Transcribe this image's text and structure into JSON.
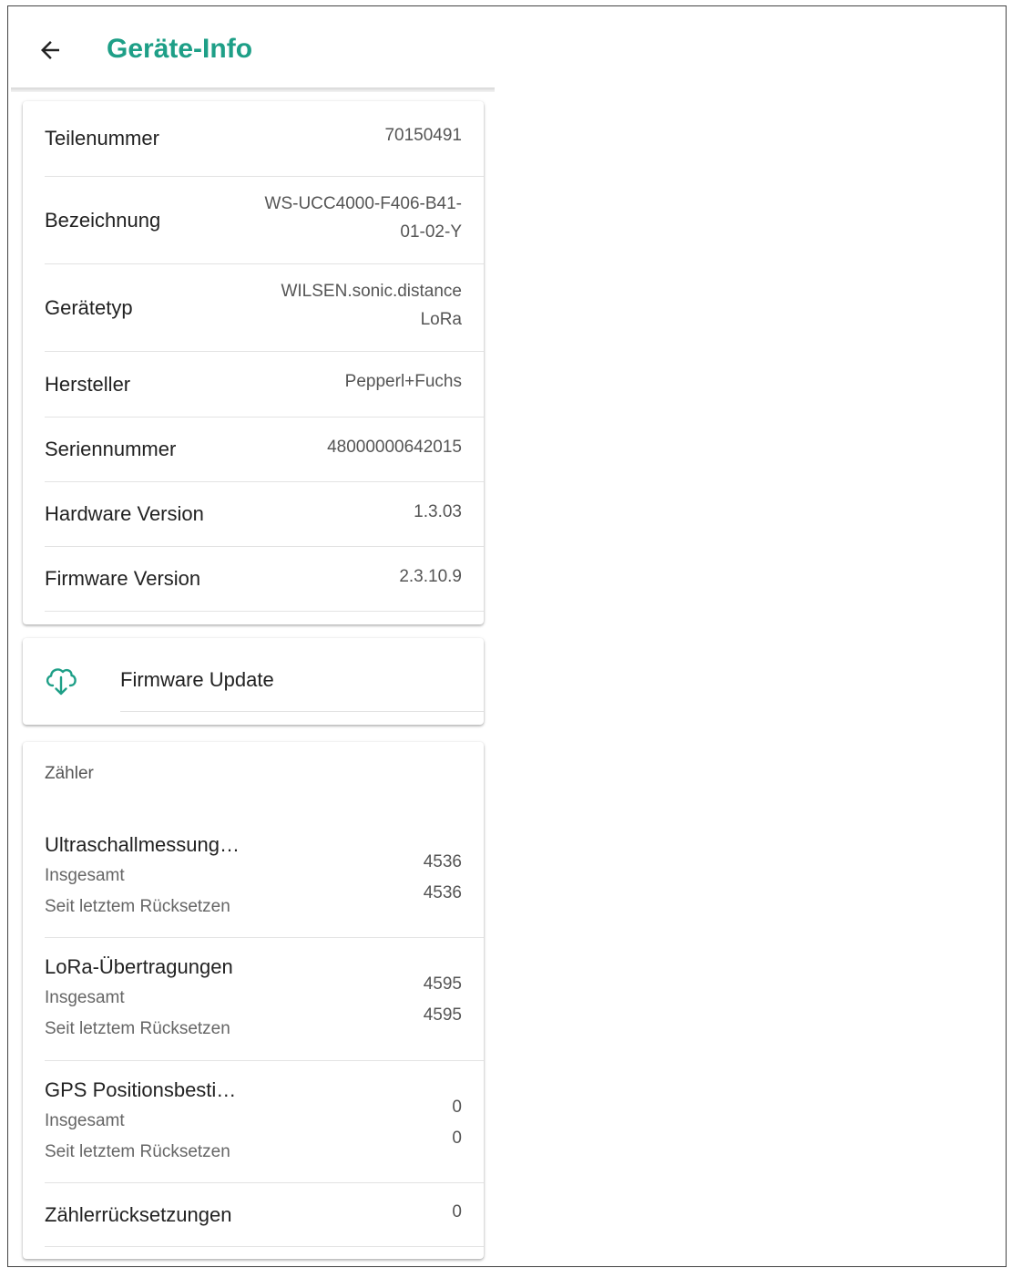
{
  "header": {
    "title": "Geräte-Info",
    "back_icon": "arrow-left-icon"
  },
  "device_info": [
    {
      "label": "Teilenummer",
      "value_lines": [
        "70150491"
      ]
    },
    {
      "label": "Bezeichnung",
      "value_lines": [
        "WS-UCC4000-F406-B41-",
        "01-02-Y"
      ]
    },
    {
      "label": "Gerätetyp",
      "value_lines": [
        "WILSEN.sonic.distance",
        "LoRa"
      ]
    },
    {
      "label": "Hersteller",
      "value_lines": [
        "Pepperl+Fuchs"
      ]
    },
    {
      "label": "Seriennummer",
      "value_lines": [
        "48000000642015"
      ]
    },
    {
      "label": "Hardware Version",
      "value_lines": [
        "1.3.03"
      ]
    },
    {
      "label": "Firmware Version",
      "value_lines": [
        "2.3.10.9"
      ]
    }
  ],
  "firmware_update": {
    "label": "Firmware Update",
    "icon": "cloud-download-icon"
  },
  "counters": {
    "section_title": "Zähler",
    "items": [
      {
        "title": "Ultraschallmessung…",
        "total_label": "Insgesamt",
        "reset_label": "Seit letztem Rücksetzen",
        "total": "4536",
        "since_reset": "4536"
      },
      {
        "title": "LoRa-Übertragungen",
        "total_label": "Insgesamt",
        "reset_label": "Seit letztem Rücksetzen",
        "total": "4595",
        "since_reset": "4595"
      },
      {
        "title": "GPS Positionsbesti…",
        "total_label": "Insgesamt",
        "reset_label": "Seit letztem Rücksetzen",
        "total": "0",
        "since_reset": "0"
      }
    ],
    "resets": {
      "label": "Zählerrücksetzungen",
      "value": "0"
    }
  },
  "colors": {
    "accent": "#1e9f87",
    "text": "#222222",
    "secondary_text": "#555555",
    "divider": "#e3e3e3"
  }
}
